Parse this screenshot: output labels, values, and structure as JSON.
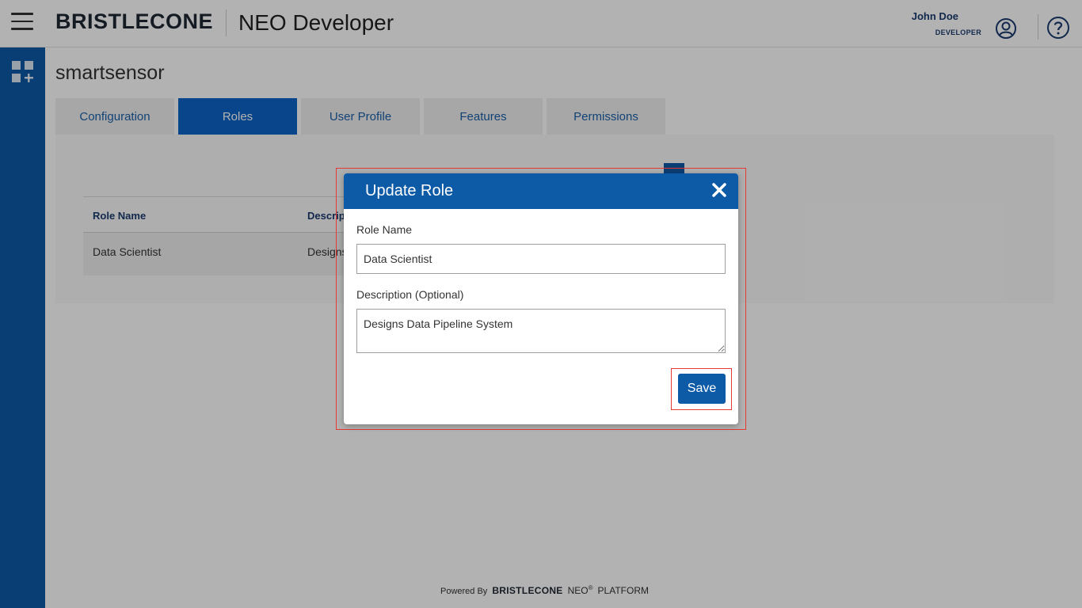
{
  "header": {
    "brand": "BRISTLECONE",
    "app_title": "NEO Developer",
    "user_name": "John Doe",
    "user_role": "DEVELOPER",
    "icons": [
      "menu-icon",
      "user-circle-icon",
      "help-icon"
    ]
  },
  "sidebar": {
    "icons": [
      "apps-add-icon"
    ]
  },
  "page": {
    "title": "smartsensor"
  },
  "tabs": [
    {
      "label": "Configuration",
      "active": false
    },
    {
      "label": "Roles",
      "active": true
    },
    {
      "label": "User Profile",
      "active": false
    },
    {
      "label": "Features",
      "active": false
    },
    {
      "label": "Permissions",
      "active": false
    }
  ],
  "table": {
    "headers": [
      "Role Name",
      "Descrip"
    ],
    "rows": [
      [
        "Data Scientist",
        "Designs"
      ]
    ]
  },
  "modal": {
    "title": "Update Role",
    "role_name_label": "Role Name",
    "role_name_value": "Data Scientist",
    "description_label": "Description (Optional)",
    "description_value": "Designs Data Pipeline System",
    "save_label": "Save"
  },
  "footer": {
    "powered_by": "Powered By",
    "brand": "BRISTLECONE",
    "neo": "NEO",
    "reg": "®",
    "platform": "PLATFORM"
  },
  "colors": {
    "primary": "#0d5aa7",
    "active_tab": "#0d63c7",
    "highlight": "#e53935"
  }
}
